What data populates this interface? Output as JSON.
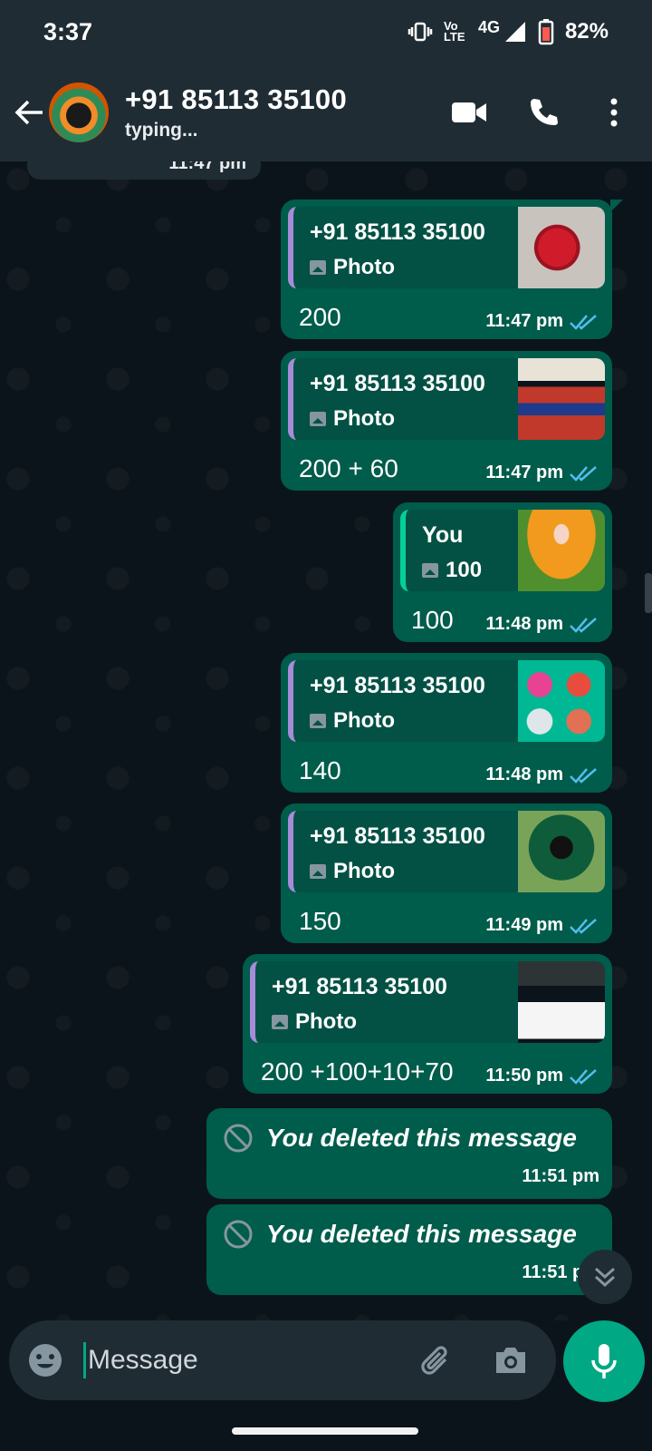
{
  "status_bar": {
    "time": "3:37",
    "network": "4G",
    "volte": "Vo LTE",
    "battery": "82%"
  },
  "header": {
    "contact_name": "+91 85113 35100",
    "status": "typing..."
  },
  "chat": {
    "previous_time": "11:47 pm",
    "messages": [
      {
        "quote_author": "+91 85113 35100",
        "quote_type": "Photo",
        "text": "200",
        "time": "11:47 pm"
      },
      {
        "quote_author": "+91 85113 35100",
        "quote_type": "Photo",
        "text": "200 + 60",
        "time": "11:47 pm"
      },
      {
        "quote_author": "You",
        "quote_type": "100",
        "text": "100",
        "time": "11:48 pm"
      },
      {
        "quote_author": "+91 85113 35100",
        "quote_type": "Photo",
        "text": "140",
        "time": "11:48 pm"
      },
      {
        "quote_author": "+91 85113 35100",
        "quote_type": "Photo",
        "text": "150",
        "time": "11:49 pm"
      },
      {
        "quote_author": "+91 85113 35100",
        "quote_type": "Photo",
        "text": "200 +100+10+70",
        "time": "11:50 pm"
      },
      {
        "text": "You deleted this message",
        "time": "11:51 pm"
      },
      {
        "text": "You deleted this message",
        "time": "11:51 pm"
      }
    ]
  },
  "input": {
    "placeholder": "Message"
  },
  "icons": {
    "back": "arrow-left-icon",
    "video": "video-call-icon",
    "call": "phone-icon",
    "menu": "more-vert-icon",
    "emoji": "emoji-icon",
    "attach": "paperclip-icon",
    "camera": "camera-icon",
    "mic": "mic-icon",
    "read": "double-check-icon",
    "deleted": "blocked-icon",
    "scroll": "chevron-double-down-icon"
  },
  "colors": {
    "bubble_out": "#005c4b",
    "header": "#1f2c34",
    "background": "#0b141a",
    "accent": "#00a884",
    "read_tick": "#53bdeb"
  }
}
